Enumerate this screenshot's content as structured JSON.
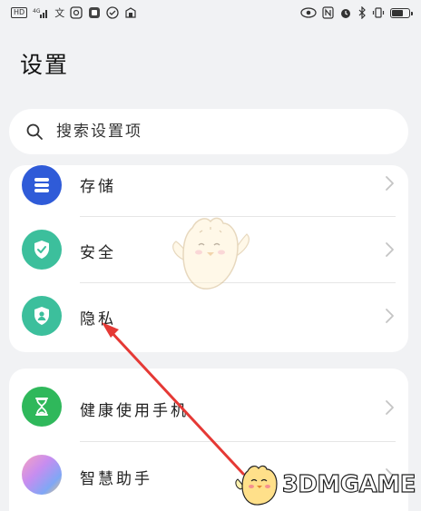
{
  "status_bar": {
    "left_items": [
      "HD",
      "4G",
      "文"
    ],
    "battery_level": 0.7
  },
  "page": {
    "title": "设置"
  },
  "search": {
    "placeholder": "搜索设置项"
  },
  "group1": {
    "items": [
      {
        "label": "存储",
        "icon": "storage-icon",
        "color": "#2f5bd8"
      },
      {
        "label": "安全",
        "icon": "shield-check-icon",
        "color": "#3cbf9c"
      },
      {
        "label": "隐私",
        "icon": "privacy-icon",
        "color": "#3cbf9c"
      }
    ]
  },
  "group2": {
    "items": [
      {
        "label": "健康使用手机",
        "icon": "hourglass-icon",
        "color": "#2fb85b"
      },
      {
        "label": "智慧助手",
        "icon": "assistant-icon",
        "color": "#9b6be6"
      }
    ]
  },
  "annotation": {
    "arrow_color": "#e53935"
  },
  "watermark": {
    "text": "3DMGAME"
  }
}
